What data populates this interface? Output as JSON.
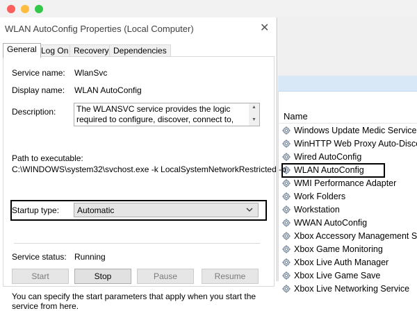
{
  "dialog": {
    "title": "WLAN AutoConfig Properties (Local Computer)",
    "close_glyph": "✕",
    "tabs": [
      {
        "label": "General",
        "active": true
      },
      {
        "label": "Log On",
        "active": false
      },
      {
        "label": "Recovery",
        "active": false
      },
      {
        "label": "Dependencies",
        "active": false
      }
    ],
    "general": {
      "service_name_label": "Service name:",
      "service_name_value": "WlanSvc",
      "display_name_label": "Display name:",
      "display_name_value": "WLAN AutoConfig",
      "description_label": "Description:",
      "description_value": "The WLANSVC service provides the logic required to configure, discover, connect to, and disconnect",
      "path_label": "Path to executable:",
      "path_value": "C:\\WINDOWS\\system32\\svchost.exe -k LocalSystemNetworkRestricted -p",
      "startup_type_label": "Startup type:",
      "startup_type_value": "Automatic",
      "service_status_label": "Service status:",
      "service_status_value": "Running",
      "buttons": {
        "start": "Start",
        "stop": "Stop",
        "pause": "Pause",
        "resume": "Resume"
      },
      "start_params_text": "You can specify the start parameters that apply when you start the service from here."
    }
  },
  "services": {
    "column_header": "Name",
    "highlighted": "WLAN AutoConfig",
    "items": [
      "Windows Update Medic Service",
      "WinHTTP Web Proxy Auto-Discovery Service",
      "Wired AutoConfig",
      "WLAN AutoConfig",
      "WMI Performance Adapter",
      "Work Folders",
      "Workstation",
      "WWAN AutoConfig",
      "Xbox Accessory Management Service",
      "Xbox Game Monitoring",
      "Xbox Live Auth Manager",
      "Xbox Live Game Save",
      "Xbox Live Networking Service"
    ]
  },
  "colors": {
    "mac_red": "#fc605c",
    "mac_yellow": "#fdbc40",
    "mac_green": "#34c84a",
    "services_header_blue": "#d9e8f6",
    "highlight_outline": "#000000"
  },
  "icons": {
    "service_item": "gear-icon",
    "dropdown": "chevron-down-icon",
    "close": "close-icon"
  }
}
